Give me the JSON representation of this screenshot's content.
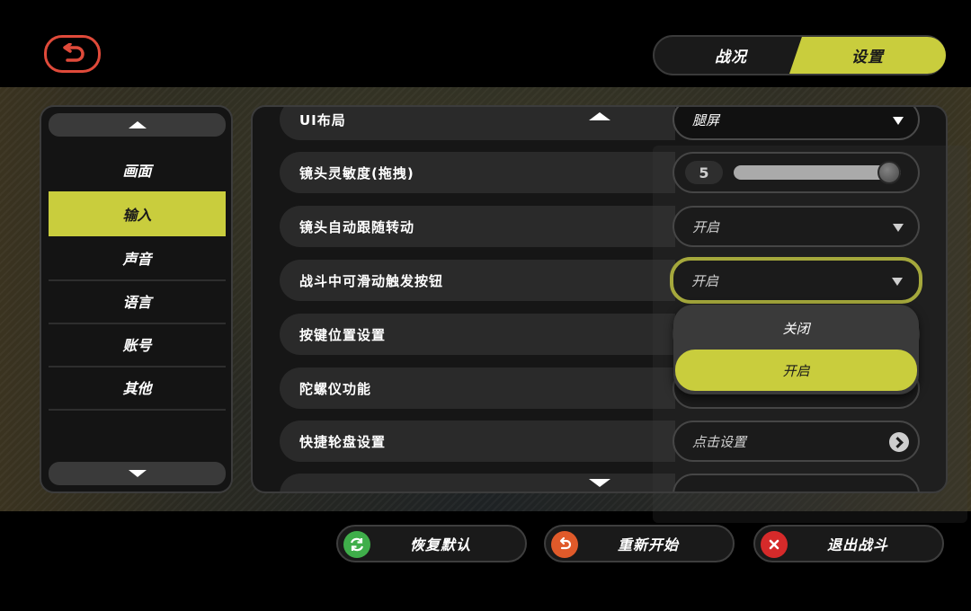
{
  "header": {
    "tabs": [
      {
        "label": "战况",
        "active": false
      },
      {
        "label": "设置",
        "active": true
      }
    ]
  },
  "sidebar": {
    "items": [
      {
        "label": "画面"
      },
      {
        "label": "输入"
      },
      {
        "label": "声音"
      },
      {
        "label": "语言"
      },
      {
        "label": "账号"
      },
      {
        "label": "其他"
      }
    ],
    "active_index": 1
  },
  "settings": {
    "rows": [
      {
        "label": "UI布局",
        "value": "腿屏"
      },
      {
        "label": "镜头灵敏度(拖拽)",
        "value": "5"
      },
      {
        "label": "镜头自动跟随转动",
        "value": "开启"
      },
      {
        "label": "战斗中可滑动触发按钮",
        "value": "开启"
      },
      {
        "label": "按键位置设置",
        "value": ""
      },
      {
        "label": "陀螺仪功能",
        "value": ""
      },
      {
        "label": "快捷轮盘设置",
        "value": "点击设置"
      }
    ],
    "slider": {
      "value": 5,
      "min": 0,
      "max": 5
    }
  },
  "dropdown": {
    "options": [
      "关闭",
      "开启"
    ],
    "selected": "开启"
  },
  "footer": {
    "restore_label": "恢复默认",
    "restart_label": "重新开始",
    "exit_label": "退出战斗"
  },
  "colors": {
    "accent": "#c9cd3d",
    "back": "#e04a3a",
    "restore": "#3fae4a",
    "restart": "#e05a2a",
    "exit": "#d62a2a"
  }
}
